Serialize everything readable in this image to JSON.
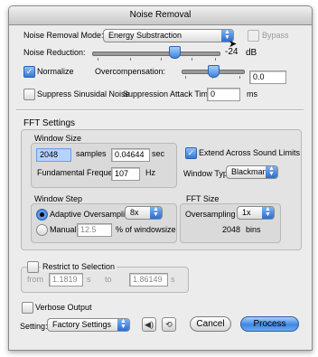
{
  "window": {
    "title": "Noise Removal"
  },
  "noise_removal_mode": {
    "label": "Noise Removal Mode:",
    "value": "Energy Substraction"
  },
  "bypass": {
    "label": "Bypass",
    "checked": false
  },
  "noise_reduction": {
    "label": "Noise Reduction:",
    "value": "-24",
    "unit": "dB"
  },
  "normalize": {
    "label": "Normalize",
    "checked": true
  },
  "overcompensation": {
    "label": "Overcompensation:",
    "value": "0.0"
  },
  "suppress_sinusoidal": {
    "label": "Suppress Sinusidal Noise",
    "checked": false
  },
  "suppression_attack": {
    "label": "Suppression Attack Time",
    "value": "0",
    "unit": "ms"
  },
  "fft": {
    "title": "FFT Settings",
    "window_size": {
      "title": "Window Size",
      "samples_value": "2048",
      "samples_unit": "samples",
      "sec_value": "0.04644",
      "sec_unit": "sec",
      "fundamental_label": "Fundamental Frequency",
      "fundamental_value": "107",
      "fundamental_unit": "Hz"
    },
    "extend": {
      "label": "Extend Across Sound Limits",
      "checked": true
    },
    "window_type": {
      "label": "Window Type",
      "value": "Blackman"
    },
    "window_step": {
      "title": "Window Step",
      "adaptive_label": "Adaptive Oversampling",
      "adaptive_value": "8x",
      "manual_label": "Manual",
      "manual_value": "12.5",
      "manual_unit": "% of windowsize"
    },
    "fft_size": {
      "title": "FFT Size",
      "oversampling_label": "Oversampling",
      "oversampling_value": "1x",
      "bins_value": "2048",
      "bins_unit": "bins"
    }
  },
  "restrict": {
    "label": "Restrict to Selection",
    "checked": false,
    "from_label": "from",
    "from_value": "1.1819",
    "from_unit": "s",
    "to_label": "to",
    "to_value": "1.86149",
    "to_unit": "s"
  },
  "verbose": {
    "label": "Verbose Output",
    "checked": false
  },
  "footer": {
    "setting_label": "Setting:",
    "setting_value": "Factory Settings",
    "cancel_label": "Cancel",
    "process_label": "Process"
  }
}
